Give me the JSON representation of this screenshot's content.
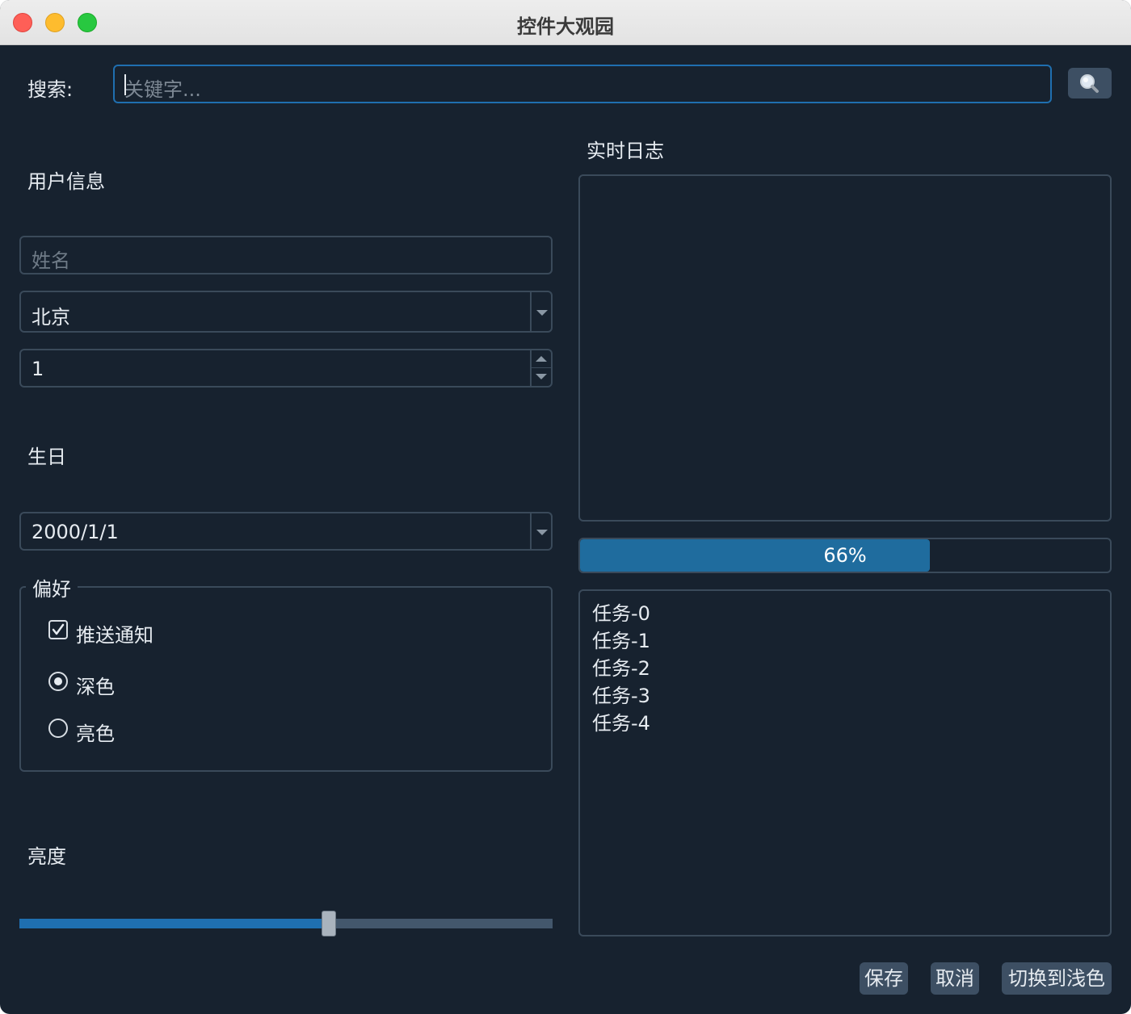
{
  "window": {
    "title": "控件大观园"
  },
  "search": {
    "label": "搜索:",
    "placeholder": "关键字...",
    "button_icon": "search-icon"
  },
  "user": {
    "section_title": "用户信息",
    "name_placeholder": "姓名",
    "city": "北京",
    "quantity": "1"
  },
  "birthday": {
    "label": "生日",
    "value": "2000/1/1"
  },
  "preferences": {
    "title": "偏好",
    "push_label": "推送通知",
    "push_checked": true,
    "theme_options": [
      "深色",
      "亮色"
    ],
    "theme_selected": "深色"
  },
  "brightness": {
    "label": "亮度",
    "value": 0.58
  },
  "log": {
    "title": "实时日志"
  },
  "progress": {
    "value": 66,
    "text": "66%"
  },
  "tasks": [
    "任务-0",
    "任务-1",
    "任务-2",
    "任务-3",
    "任务-4"
  ],
  "buttons": {
    "save": "保存",
    "cancel": "取消",
    "toggle_theme": "切换到浅色"
  },
  "colors": {
    "accent": "#1f6fb0",
    "background": "#17222f",
    "progress": "#1f6c9e"
  }
}
